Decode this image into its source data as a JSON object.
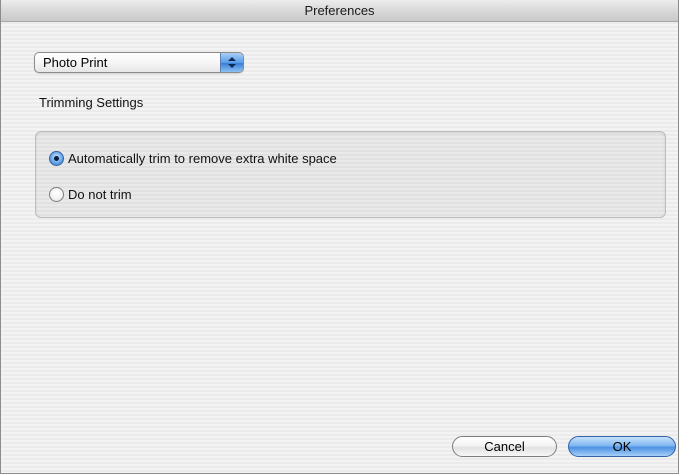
{
  "window": {
    "title": "Preferences"
  },
  "popup": {
    "selected": "Photo Print"
  },
  "trimming": {
    "heading": "Trimming Settings",
    "options": [
      {
        "label": "Automatically trim to remove extra white space",
        "selected": true
      },
      {
        "label": "Do not trim",
        "selected": false
      }
    ]
  },
  "buttons": {
    "cancel": "Cancel",
    "ok": "OK"
  },
  "colors": {
    "accent": "#4d91e4",
    "window_background": "#ececec"
  }
}
